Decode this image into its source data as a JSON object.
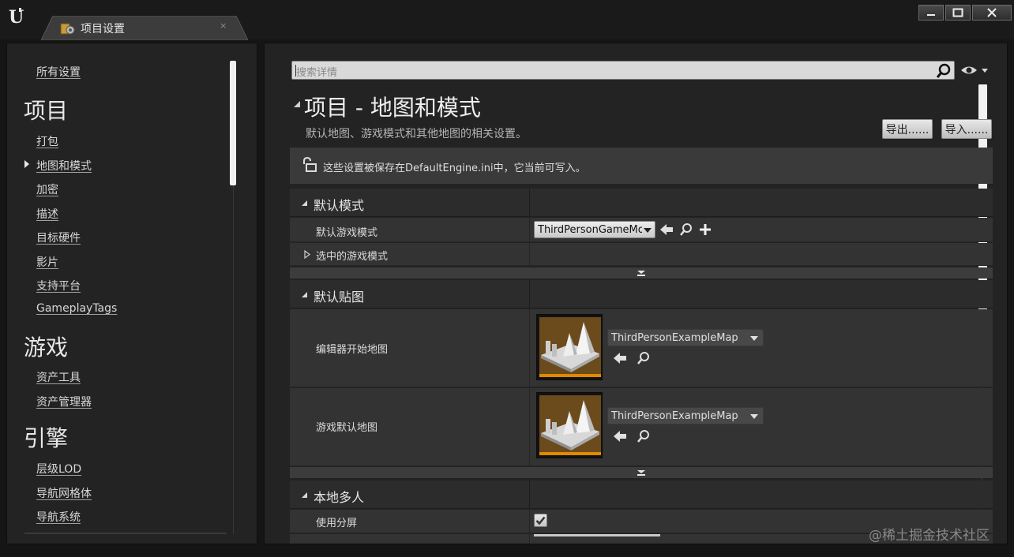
{
  "window": {
    "tab_label": "项目设置",
    "tab_close": "×"
  },
  "nav": {
    "all_settings": "所有设置",
    "sections": [
      {
        "heading": "项目",
        "items": [
          "打包",
          "地图和模式",
          "加密",
          "描述",
          "目标硬件",
          "影片",
          "支持平台",
          "GameplayTags"
        ]
      },
      {
        "heading": "游戏",
        "items": [
          "资产工具",
          "资产管理器"
        ]
      },
      {
        "heading": "引擎",
        "items": [
          "层级LOD",
          "导航网格体",
          "导航系统"
        ]
      }
    ],
    "selected": "地图和模式"
  },
  "search": {
    "placeholder": "搜索详情"
  },
  "header": {
    "title": "项目 - 地图和模式",
    "description": "默认地图、游戏模式和其他地图的相关设置。",
    "export_label": "导出......",
    "import_label": "导入......"
  },
  "info": {
    "text": "这些设置被保存在DefaultEngine.ini中，它当前可写入。"
  },
  "categories": {
    "default_modes": {
      "label": "默认模式",
      "default_gamemode_label": "默认游戏模式",
      "default_gamemode_value": "ThirdPersonGameMod",
      "selected_gamemode_label": "选中的游戏模式"
    },
    "default_maps": {
      "label": "默认贴图",
      "editor_startup_label": "编辑器开始地图",
      "editor_startup_value": "ThirdPersonExampleMap",
      "game_default_label": "游戏默认地图",
      "game_default_value": "ThirdPersonExampleMap"
    },
    "local_multiplayer": {
      "label": "本地多人",
      "use_splitscreen_label": "使用分屏",
      "use_splitscreen_checked": true
    }
  },
  "watermark": "@稀土掘金技术社区",
  "colors": {
    "accent_orange": "#e08a00",
    "panel_bg": "#232323",
    "row_bg": "#333333"
  }
}
